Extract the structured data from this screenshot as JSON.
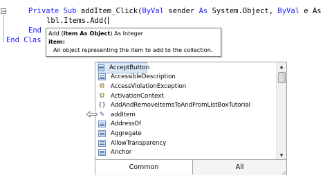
{
  "editor": {
    "collapse_toggle": "−",
    "line1_kw1": "Private Sub",
    "line1_rest_a": " addItem_Click(",
    "line1_kw2": "ByVal",
    "line1_rest_b": " sender ",
    "line1_kw3": "As",
    "line1_rest_c": " System.Object, ",
    "line1_kw4": "ByVal",
    "line1_rest_d": " e As",
    "line2": "lbl.Items.Add(",
    "line3_kw": "End",
    "line4_kw": "End Clas"
  },
  "tooltip": {
    "sig_prefix": "Add (",
    "sig_param": "item As Object",
    "sig_suffix": ") As Integer",
    "param_name": "item:",
    "param_desc": "An object representing the item to add to the collection."
  },
  "intellisense": {
    "items": [
      {
        "label": "AcceptButton",
        "icon": "property-icon",
        "selected": true
      },
      {
        "label": "AccessibleDescription",
        "icon": "property-icon"
      },
      {
        "label": "AccessViolationException",
        "icon": "class-icon"
      },
      {
        "label": "ActivationContext",
        "icon": "class-icon"
      },
      {
        "label": "AddAndRemoveItemsToAndFromListBoxTutorial",
        "icon": "namespace-icon"
      },
      {
        "label": "addItem",
        "icon": "method-icon"
      },
      {
        "label": "AddressOf",
        "icon": "property-icon"
      },
      {
        "label": "Aggregate",
        "icon": "property-icon"
      },
      {
        "label": "AllowTransparency",
        "icon": "property-icon"
      },
      {
        "label": "Anchor",
        "icon": "property-icon"
      }
    ],
    "scroll_up": "▲",
    "scroll_down": "▼",
    "tab_common": "Common",
    "tab_all": "All"
  },
  "colors": {
    "keyword": "#1a1aff",
    "selection": "#dbe8f7"
  }
}
